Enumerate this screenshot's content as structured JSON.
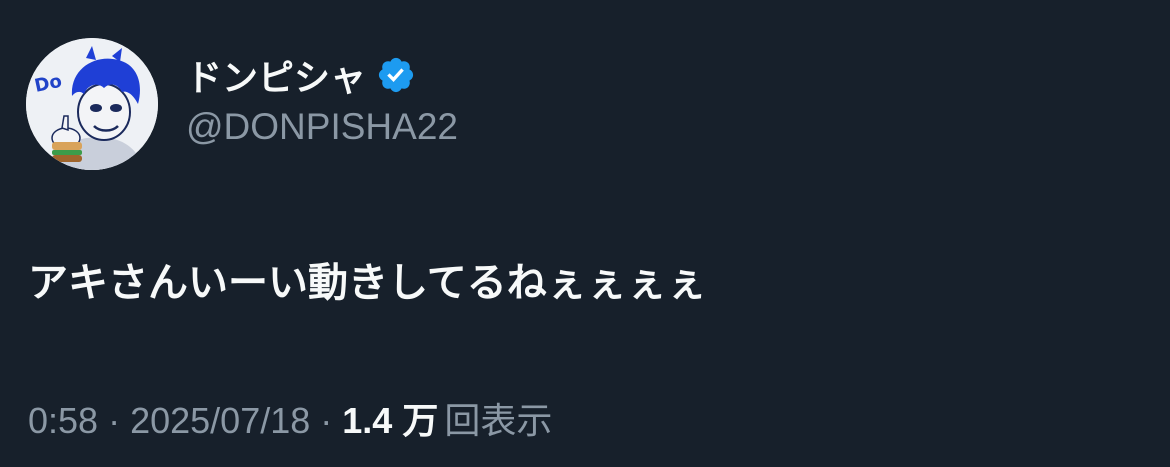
{
  "author": {
    "display_name": "ドンピシャ",
    "handle": "@DONPISHA22",
    "verified": true,
    "verified_icon": "verified-badge-icon",
    "avatar": "avatar-blue-haired-character-holding-burger"
  },
  "tweet": {
    "text": "アキさんいーい動きしてるねぇぇぇぇ"
  },
  "meta": {
    "time": "0:58",
    "separator": "·",
    "date": "2025/07/18",
    "views_count": "1.4 万",
    "views_label": "回表示"
  },
  "colors": {
    "background": "#17202b",
    "primary_text": "#f7f9f9",
    "secondary_text": "#8b98a5",
    "verified_blue": "#1d9bf0"
  }
}
